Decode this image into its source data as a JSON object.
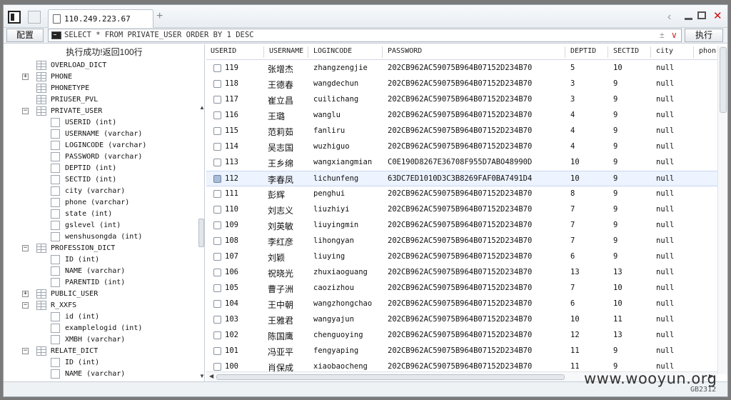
{
  "tabbar": {
    "tab_title": "110.249.223.67",
    "new_tab": "+",
    "back": "‹",
    "close": "✕"
  },
  "toolbar": {
    "config_label": "配置",
    "sql": "SELECT * FROM PRIVATE_USER ORDER BY 1 DESC",
    "plusminus": "±",
    "dropdown": "∨",
    "execute_label": "执行"
  },
  "status": "执行成功!返回100行",
  "tree": [
    {
      "name": "OVERLOAD_DICT",
      "level": 0,
      "type": "table",
      "expander": ""
    },
    {
      "name": "PHONE",
      "level": 0,
      "type": "table",
      "expander": "+"
    },
    {
      "name": "PHONETYPE",
      "level": 0,
      "type": "table",
      "expander": ""
    },
    {
      "name": "PRIUSER_PVL",
      "level": 0,
      "type": "table",
      "expander": ""
    },
    {
      "name": "PRIVATE_USER",
      "level": 0,
      "type": "table",
      "expander": "−"
    },
    {
      "name": "USERID  (int)",
      "level": 1,
      "type": "col",
      "expander": ""
    },
    {
      "name": "USERNAME  (varchar)",
      "level": 1,
      "type": "col",
      "expander": ""
    },
    {
      "name": "LOGINCODE  (varchar)",
      "level": 1,
      "type": "col",
      "expander": ""
    },
    {
      "name": "PASSWORD  (varchar)",
      "level": 1,
      "type": "col",
      "expander": ""
    },
    {
      "name": "DEPTID  (int)",
      "level": 1,
      "type": "col",
      "expander": ""
    },
    {
      "name": "SECTID  (int)",
      "level": 1,
      "type": "col",
      "expander": ""
    },
    {
      "name": "city  (varchar)",
      "level": 1,
      "type": "col",
      "expander": ""
    },
    {
      "name": "phone  (varchar)",
      "level": 1,
      "type": "col",
      "expander": ""
    },
    {
      "name": "state  (int)",
      "level": 1,
      "type": "col",
      "expander": ""
    },
    {
      "name": "gslevel  (int)",
      "level": 1,
      "type": "col",
      "expander": ""
    },
    {
      "name": "wenshusongda  (int)",
      "level": 1,
      "type": "col",
      "expander": ""
    },
    {
      "name": "PROFESSION_DICT",
      "level": 0,
      "type": "table",
      "expander": "−"
    },
    {
      "name": "ID  (int)",
      "level": 1,
      "type": "col",
      "expander": ""
    },
    {
      "name": "NAME  (varchar)",
      "level": 1,
      "type": "col",
      "expander": ""
    },
    {
      "name": "PARENTID  (int)",
      "level": 1,
      "type": "col",
      "expander": ""
    },
    {
      "name": "PUBLIC_USER",
      "level": 0,
      "type": "table",
      "expander": "+"
    },
    {
      "name": "R_XXFS",
      "level": 0,
      "type": "table",
      "expander": "−"
    },
    {
      "name": "id  (int)",
      "level": 1,
      "type": "col",
      "expander": ""
    },
    {
      "name": "examplelogid  (int)",
      "level": 1,
      "type": "col",
      "expander": ""
    },
    {
      "name": "XMBH  (varchar)",
      "level": 1,
      "type": "col",
      "expander": ""
    },
    {
      "name": "RELATE_DICT",
      "level": 0,
      "type": "table",
      "expander": "−"
    },
    {
      "name": "ID  (int)",
      "level": 1,
      "type": "col",
      "expander": ""
    },
    {
      "name": "NAME  (varchar)",
      "level": 1,
      "type": "col",
      "expander": ""
    }
  ],
  "grid": {
    "columns": [
      "USERID",
      "USERNAME",
      "LOGINCODE",
      "PASSWORD",
      "DEPTID",
      "SECTID",
      "city",
      "phon"
    ],
    "selected_userid": "112",
    "rows": [
      [
        "119",
        "张增杰",
        "zhangzengjie",
        "202CB962AC59075B964B07152D234B70",
        "5",
        "10",
        "null"
      ],
      [
        "118",
        "王德春",
        "wangdechun",
        "202CB962AC59075B964B07152D234B70",
        "3",
        "9",
        "null"
      ],
      [
        "117",
        "崔立昌",
        "cuilichang",
        "202CB962AC59075B964B07152D234B70",
        "3",
        "9",
        "null"
      ],
      [
        "116",
        "王璐",
        "wanglu",
        "202CB962AC59075B964B07152D234B70",
        "4",
        "9",
        "null"
      ],
      [
        "115",
        "范莉茹",
        "fanliru",
        "202CB962AC59075B964B07152D234B70",
        "4",
        "9",
        "null"
      ],
      [
        "114",
        "吴志国",
        "wuzhiguo",
        "202CB962AC59075B964B07152D234B70",
        "4",
        "9",
        "null"
      ],
      [
        "113",
        "王乡绵",
        "wangxiangmian",
        "C0E190D8267E36708F955D7ABO48990D",
        "10",
        "9",
        "null"
      ],
      [
        "112",
        "李春凤",
        "lichunfeng",
        "63DC7ED1010D3C3B8269FAF0BA7491D4",
        "10",
        "9",
        "null"
      ],
      [
        "111",
        "彭辉",
        "penghui",
        "202CB962AC59075B964B07152D234B70",
        "8",
        "9",
        "null"
      ],
      [
        "110",
        "刘志义",
        "liuzhiyi",
        "202CB962AC59075B964B07152D234B70",
        "7",
        "9",
        "null"
      ],
      [
        "109",
        "刘英敏",
        "liuyingmin",
        "202CB962AC59075B964B07152D234B70",
        "7",
        "9",
        "null"
      ],
      [
        "108",
        "李红彦",
        "lihongyan",
        "202CB962AC59075B964B07152D234B70",
        "7",
        "9",
        "null"
      ],
      [
        "107",
        "刘颖",
        "liuying",
        "202CB962AC59075B964B07152D234B70",
        "6",
        "9",
        "null"
      ],
      [
        "106",
        "祝晓光",
        "zhuxiaoguang",
        "202CB962AC59075B964B07152D234B70",
        "13",
        "13",
        "null"
      ],
      [
        "105",
        "曹子洲",
        "caozizhou",
        "202CB962AC59075B964B07152D234B70",
        "7",
        "10",
        "null"
      ],
      [
        "104",
        "王中朝",
        "wangzhongchao",
        "202CB962AC59075B964B07152D234B70",
        "6",
        "10",
        "null"
      ],
      [
        "103",
        "王雅君",
        "wangyajun",
        "202CB962AC59075B964B07152D234B70",
        "10",
        "11",
        "null"
      ],
      [
        "102",
        "陈国鹰",
        "chenguoying",
        "202CB962AC59075B964B07152D234B70",
        "12",
        "13",
        "null"
      ],
      [
        "101",
        "冯亚平",
        "fengyaping",
        "202CB962AC59075B964B07152D234B70",
        "11",
        "9",
        "null"
      ],
      [
        "100",
        "肖保成",
        "xiaobaocheng",
        "202CB962AC59075B964B07152D234B70",
        "11",
        "9",
        "null"
      ]
    ]
  },
  "footer": {
    "encoding": "GB2312",
    "watermark": "www.wooyun.org"
  },
  "icons": {
    "tab": "document-icon",
    "sql": "terminal-icon",
    "table_node": "table-icon",
    "column_node": "column-icon"
  }
}
